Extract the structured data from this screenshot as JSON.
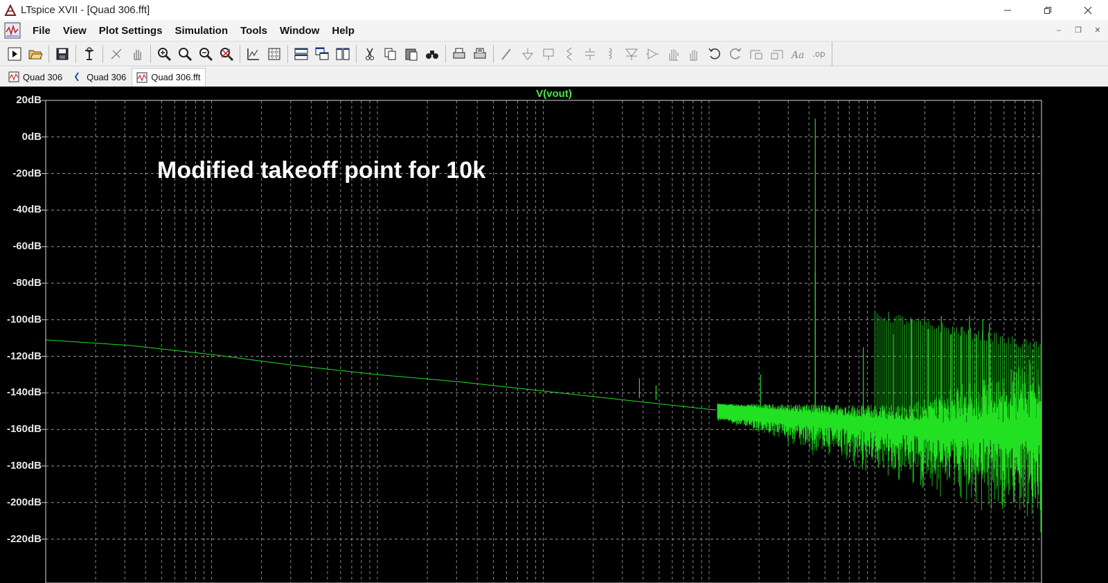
{
  "window": {
    "title": "LTspice XVII - [Quad 306.fft]",
    "controls": [
      "minimize",
      "restore",
      "close"
    ]
  },
  "menu": {
    "items": [
      "File",
      "View",
      "Plot Settings",
      "Simulation",
      "Tools",
      "Window",
      "Help"
    ]
  },
  "toolbar": {
    "buttons": [
      "run-icon",
      "open-icon",
      "save-icon",
      "control-panel-icon",
      "halt-icon",
      "pan-icon",
      "zoom-in-icon",
      "zoom-area-icon",
      "zoom-out-icon",
      "zoom-fit-icon",
      "autorange-icon",
      "grid-icon",
      "tile-horizontal-icon",
      "cascade-icon",
      "tile-vertical-icon",
      "cut-icon",
      "copy-icon",
      "paste-icon",
      "find-icon",
      "print-icon",
      "print-preview-icon",
      "wire-icon",
      "ground-icon",
      "label-icon",
      "resistor-icon",
      "capacitor-icon",
      "inductor-icon",
      "diode-icon",
      "component-icon",
      "move-icon",
      "drag-icon",
      "undo-icon",
      "redo-icon",
      "rotate-icon",
      "mirror-icon",
      "text-icon",
      "spice-directive-icon"
    ]
  },
  "tabs": [
    {
      "label": "Quad 306",
      "icon": "waveform-icon",
      "active": false
    },
    {
      "label": "Quad 306",
      "icon": "schematic-icon",
      "active": false
    },
    {
      "label": "Quad 306.fft",
      "icon": "waveform-icon",
      "active": true
    }
  ],
  "plot": {
    "trace_label": "V(vout)",
    "trace_color": "#22e022",
    "background": "#000000",
    "annotation": "Modified takeoff point for 10k"
  },
  "chart_data": {
    "type": "line",
    "title": "V(vout)",
    "xlabel": "",
    "ylabel": "",
    "y_tick_labels": [
      "20dB",
      "0dB",
      "-20dB",
      "-40dB",
      "-60dB",
      "-80dB",
      "-100dB",
      "-120dB",
      "-140dB",
      "-160dB",
      "-180dB",
      "-200dB",
      "-220dB"
    ],
    "ylim": [
      -225,
      20
    ],
    "xscale": "log",
    "x_decades": 6,
    "grid": true,
    "series": [
      {
        "name": "V(vout)",
        "color": "#22e022",
        "noise_floor_db": [
          [
            0.0,
            -111
          ],
          [
            0.5,
            -114
          ],
          [
            1.0,
            -119
          ],
          [
            1.5,
            -125
          ],
          [
            2.0,
            -130
          ],
          [
            2.5,
            -134
          ],
          [
            3.0,
            -139
          ],
          [
            3.5,
            -144
          ],
          [
            4.0,
            -149
          ],
          [
            4.5,
            -153
          ],
          [
            5.0,
            -157
          ],
          [
            5.5,
            -160
          ],
          [
            6.0,
            -163
          ]
        ],
        "fundamental": {
          "x": 4.64,
          "db": 10
        },
        "harmonics": [
          {
            "x": 4.64,
            "db": -74
          },
          {
            "x": 4.93,
            "db": -115
          },
          {
            "x": 5.11,
            "db": -108
          },
          {
            "x": 5.22,
            "db": -100
          },
          {
            "x": 5.32,
            "db": -105
          },
          {
            "x": 5.4,
            "db": -98
          },
          {
            "x": 5.46,
            "db": -108
          },
          {
            "x": 5.52,
            "db": -104
          },
          {
            "x": 5.57,
            "db": -98
          },
          {
            "x": 5.61,
            "db": -108
          },
          {
            "x": 5.65,
            "db": -100
          },
          {
            "x": 5.69,
            "db": -102
          }
        ],
        "spurs": [
          {
            "x": 3.58,
            "db": -132
          },
          {
            "x": 3.68,
            "db": -136
          },
          {
            "x": 4.31,
            "db": -130
          }
        ]
      }
    ]
  }
}
